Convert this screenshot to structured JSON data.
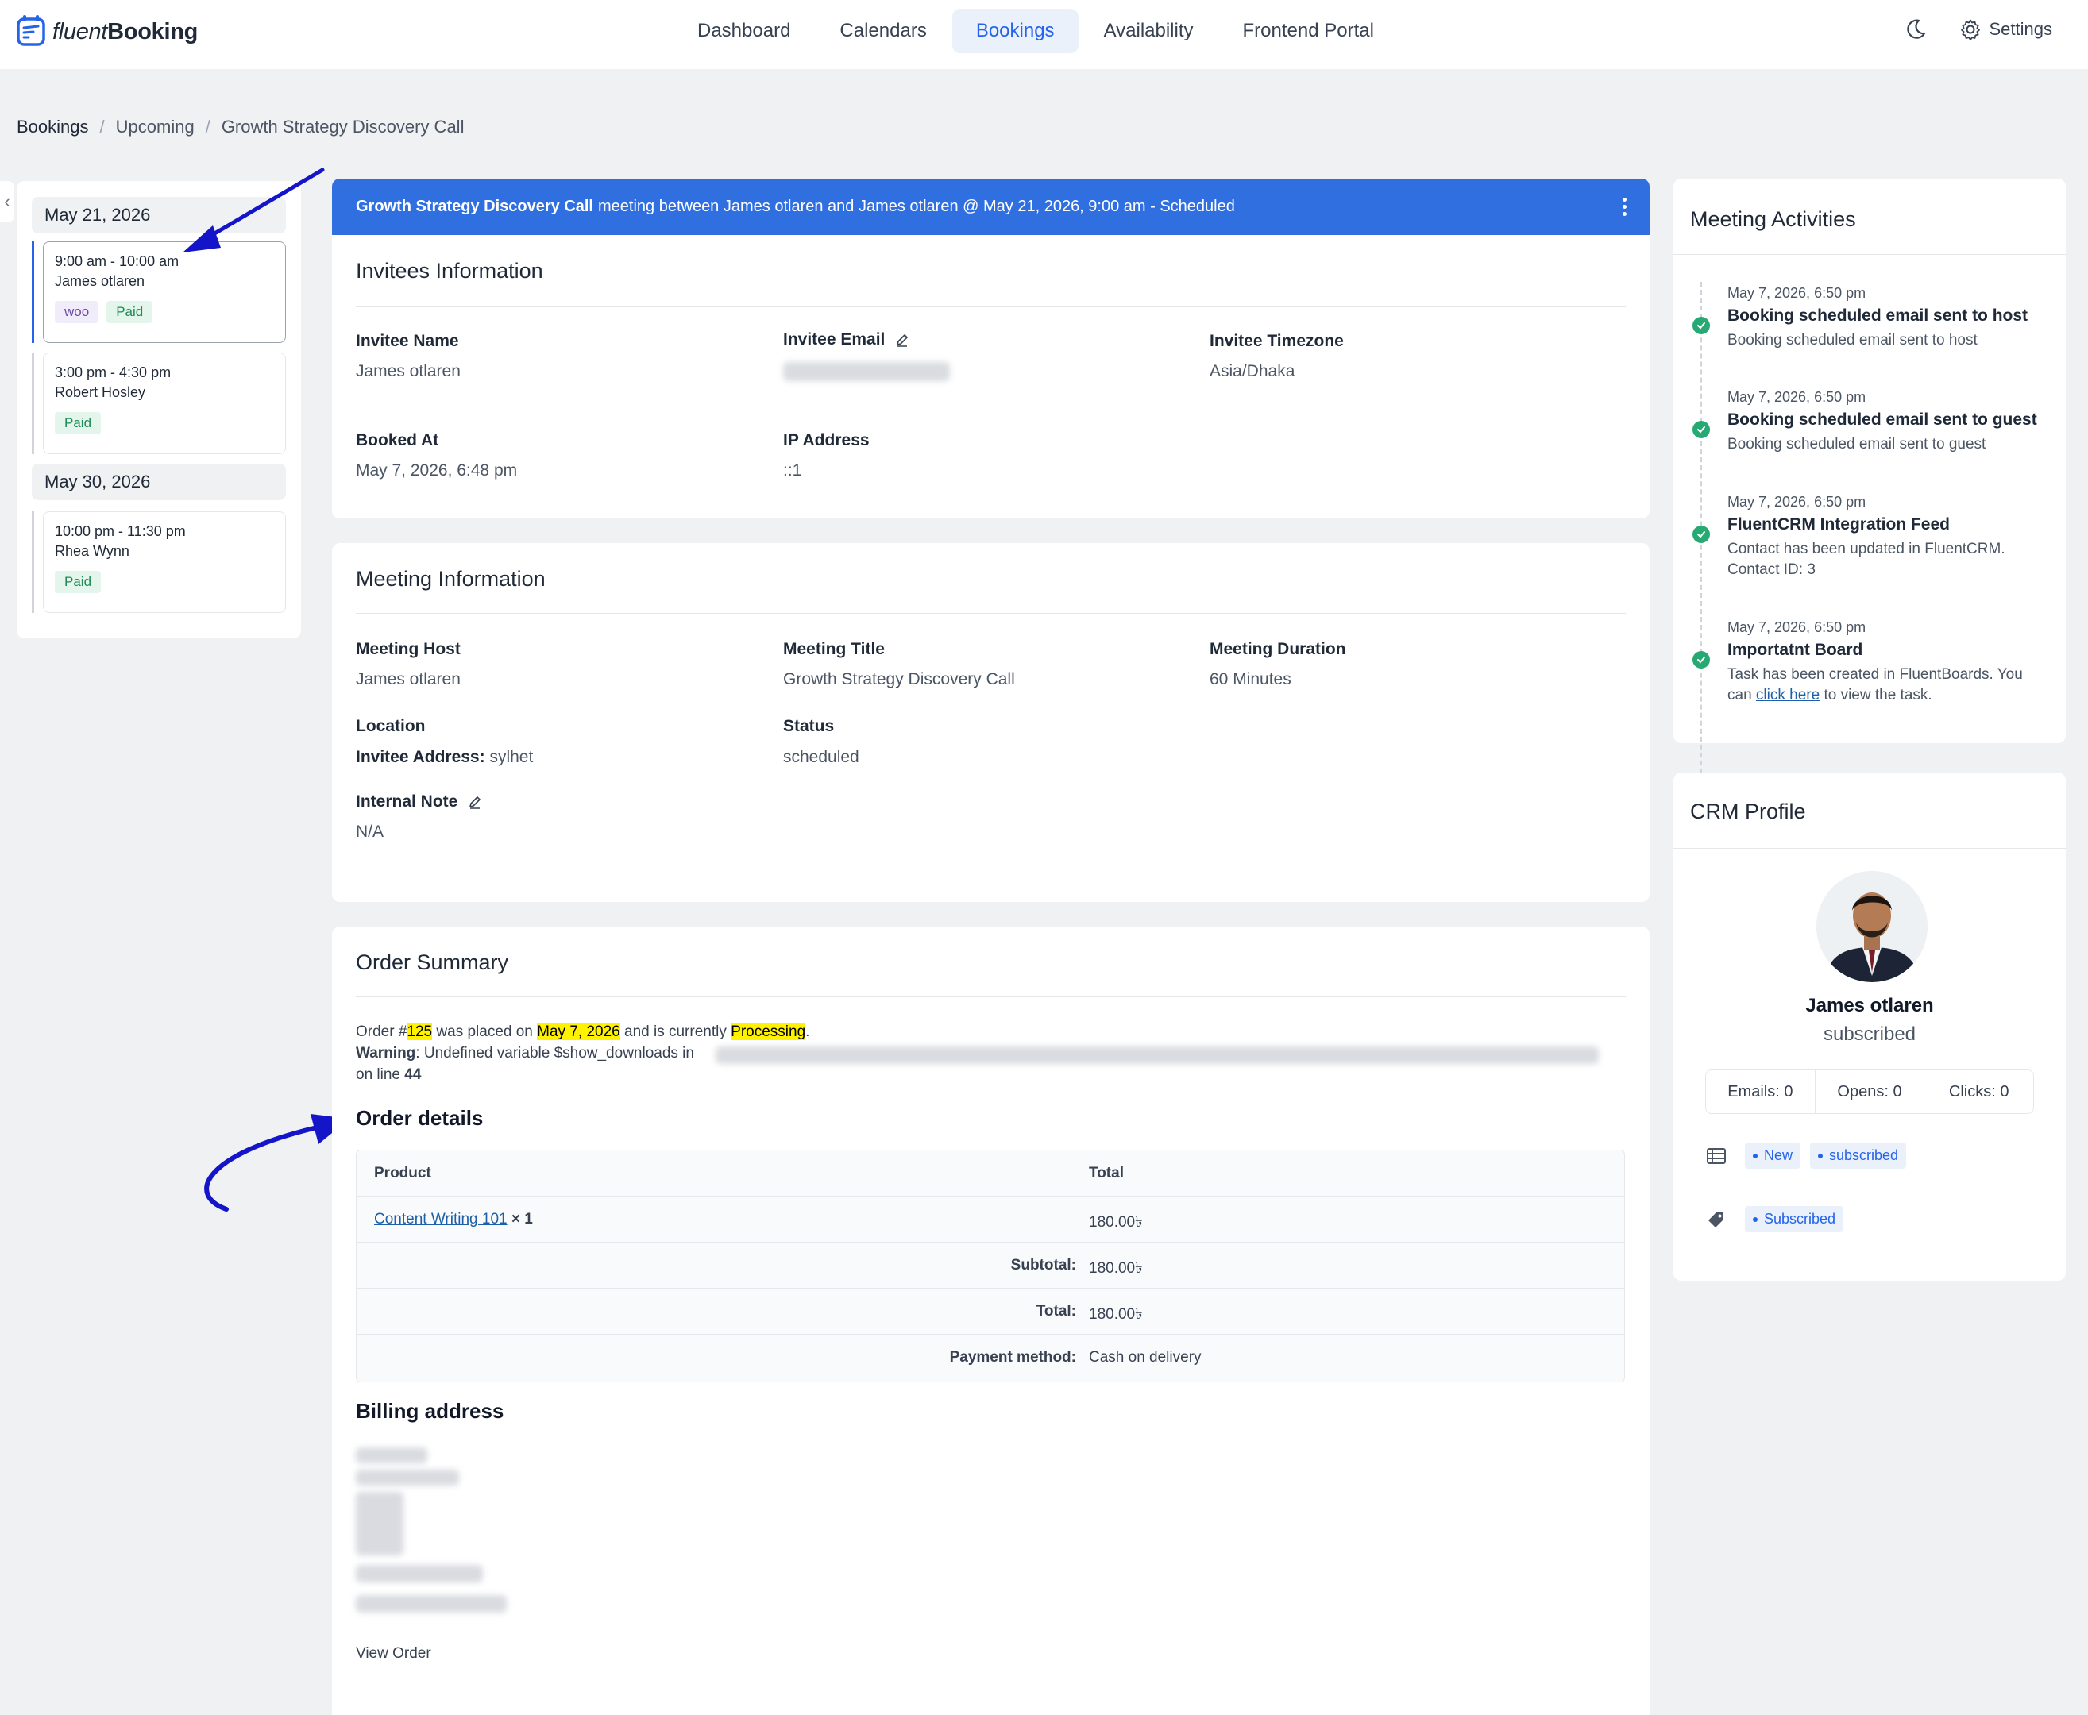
{
  "brand": {
    "light": "fluent",
    "bold": "Booking",
    "color": "#2563eb"
  },
  "nav": {
    "items": [
      "Dashboard",
      "Calendars",
      "Bookings",
      "Availability",
      "Frontend Portal"
    ],
    "active": "Bookings",
    "settings_label": "Settings"
  },
  "breadcrumb": [
    "Bookings",
    "Upcoming",
    "Growth Strategy Discovery Call"
  ],
  "bookings_list": [
    {
      "date": "May 21, 2026",
      "slots": [
        {
          "time": "9:00 am - 10:00 am",
          "name": "James otlaren",
          "badges": [
            "woo",
            "Paid"
          ],
          "active": true
        },
        {
          "time": "3:00 pm - 4:30 pm",
          "name": "Robert Hosley",
          "badges": [
            "Paid"
          ],
          "active": false
        }
      ]
    },
    {
      "date": "May 30, 2026",
      "slots": [
        {
          "time": "10:00 pm - 11:30 pm",
          "name": "Rhea Wynn",
          "badges": [
            "Paid"
          ],
          "active": false
        }
      ]
    }
  ],
  "banner": {
    "title": "Growth Strategy Discovery Call",
    "text": "meeting between James otlaren and James otlaren @ May 21, 2026, 9:00 am - Scheduled"
  },
  "invitees": {
    "heading": "Invitees Information",
    "name_label": "Invitee Name",
    "name": "James otlaren",
    "email_label": "Invitee Email",
    "timezone_label": "Invitee Timezone",
    "timezone": "Asia/Dhaka",
    "booked_label": "Booked At",
    "booked": "May 7, 2026, 6:48 pm",
    "ip_label": "IP Address",
    "ip": "::1"
  },
  "meeting": {
    "heading": "Meeting Information",
    "host_label": "Meeting Host",
    "host": "James otlaren",
    "title_label": "Meeting Title",
    "title": "Growth Strategy Discovery Call",
    "duration_label": "Meeting Duration",
    "duration": "60 Minutes",
    "location_label": "Location",
    "location_key": "Invitee Address:",
    "location_value": "sylhet",
    "status_label": "Status",
    "status": "scheduled",
    "note_label": "Internal Note",
    "note": "N/A"
  },
  "order": {
    "heading": "Order Summary",
    "line_prefix": "Order #",
    "order_no": "125",
    "placed_on": "was placed on",
    "date": "May 7, 2026",
    "currently": "and is currently",
    "state": "Processing",
    "period": ".",
    "warning_label": "Warning",
    "warning_text": ": Undefined variable $show_downloads in",
    "on_line": "on line",
    "line_no": "44",
    "details_heading": "Order details",
    "col_product": "Product",
    "col_total": "Total",
    "product_name": "Content Writing 101",
    "product_qty": "× 1",
    "product_total": "180.00৳",
    "subtotal_label": "Subtotal:",
    "subtotal": "180.00৳",
    "total_label": "Total:",
    "total": "180.00৳",
    "payment_label": "Payment method:",
    "payment": "Cash on delivery",
    "billing_heading": "Billing address",
    "view_order": "View Order"
  },
  "activities": {
    "heading": "Meeting Activities",
    "items": [
      {
        "time": "May 7, 2026, 6:50 pm",
        "title": "Booking scheduled email sent to host",
        "desc": "Booking scheduled email sent to host"
      },
      {
        "time": "May 7, 2026, 6:50 pm",
        "title": "Booking scheduled email sent to guest",
        "desc": "Booking scheduled email sent to guest"
      },
      {
        "time": "May 7, 2026, 6:50 pm",
        "title": "FluentCRM Integration Feed",
        "desc": "Contact has been updated in FluentCRM. Contact ID: 3"
      },
      {
        "time": "May 7, 2026, 6:50 pm",
        "title": "Importatnt Board",
        "desc_before": "Task has been created in FluentBoards. You can",
        "link": "click here",
        "desc_after": "to view the task."
      }
    ]
  },
  "crm": {
    "heading": "CRM Profile",
    "name": "James otlaren",
    "status": "subscribed",
    "emails": "Emails: 0",
    "opens": "Opens: 0",
    "clicks": "Clicks: 0",
    "lists": [
      "New",
      "subscribed"
    ],
    "tags": [
      "Subscribed"
    ]
  }
}
